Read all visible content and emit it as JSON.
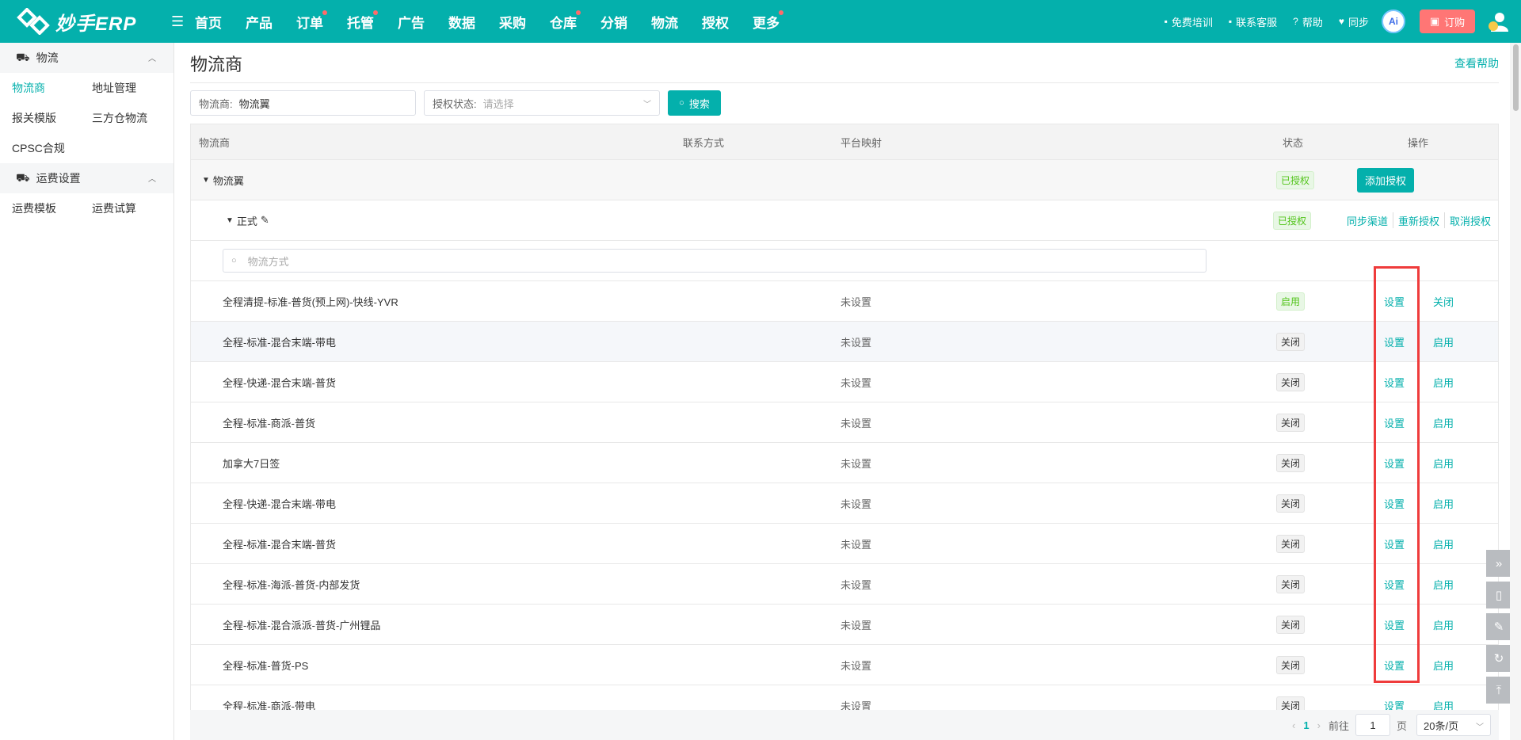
{
  "app": {
    "logo_text": "妙手ERP"
  },
  "nav": {
    "items": [
      {
        "label": "首页",
        "dot": false
      },
      {
        "label": "产品",
        "dot": false
      },
      {
        "label": "订单",
        "dot": true
      },
      {
        "label": "托管",
        "dot": true
      },
      {
        "label": "广告",
        "dot": false
      },
      {
        "label": "数据",
        "dot": false
      },
      {
        "label": "采购",
        "dot": false
      },
      {
        "label": "仓库",
        "dot": true
      },
      {
        "label": "分销",
        "dot": false
      },
      {
        "label": "物流",
        "dot": false
      },
      {
        "label": "授权",
        "dot": false
      },
      {
        "label": "更多",
        "dot": true
      }
    ],
    "tools": {
      "training": "免费培训",
      "support": "联系客服",
      "help": "帮助",
      "sync": "同步",
      "ai": "Ai",
      "order": "订购"
    }
  },
  "sidebar": {
    "group1": {
      "label": "物流"
    },
    "group1_links": [
      [
        "物流商",
        "地址管理"
      ],
      [
        "报关模版",
        "三方仓物流"
      ],
      [
        "CPSC合规"
      ]
    ],
    "group2": {
      "label": "运费设置"
    },
    "group2_links": [
      [
        "运费模板",
        "运费试算"
      ]
    ]
  },
  "page": {
    "title": "物流商",
    "help": "查看帮助"
  },
  "filters": {
    "carrier_label": "物流商:",
    "carrier_value": "物流翼",
    "auth_label": "授权状态:",
    "auth_placeholder": "请选择",
    "search_btn": "搜索"
  },
  "table": {
    "headers": {
      "carrier": "物流商",
      "contact": "联系方式",
      "mapping": "平台映射",
      "status": "状态",
      "action": "操作"
    },
    "group": {
      "name": "物流翼",
      "status": "已授权",
      "add_btn": "添加授权"
    },
    "sub": {
      "name": "正式",
      "status": "已授权",
      "sync": "同步渠道",
      "reauth": "重新授权",
      "cancel": "取消授权"
    },
    "method_placeholder": "物流方式",
    "rows": [
      {
        "name": "全程清提-标准-普货(预上网)-快线-YVR",
        "mapping": "未设置",
        "status": "启用",
        "set": "设置",
        "toggle": "关闭"
      },
      {
        "name": "全程-标准-混合末端-带电",
        "mapping": "未设置",
        "status": "关闭",
        "set": "设置",
        "toggle": "启用"
      },
      {
        "name": "全程-快递-混合末端-普货",
        "mapping": "未设置",
        "status": "关闭",
        "set": "设置",
        "toggle": "启用"
      },
      {
        "name": "全程-标准-商派-普货",
        "mapping": "未设置",
        "status": "关闭",
        "set": "设置",
        "toggle": "启用"
      },
      {
        "name": "加拿大7日签",
        "mapping": "未设置",
        "status": "关闭",
        "set": "设置",
        "toggle": "启用"
      },
      {
        "name": "全程-快递-混合末端-带电",
        "mapping": "未设置",
        "status": "关闭",
        "set": "设置",
        "toggle": "启用"
      },
      {
        "name": "全程-标准-混合末端-普货",
        "mapping": "未设置",
        "status": "关闭",
        "set": "设置",
        "toggle": "启用"
      },
      {
        "name": "全程-标准-海派-普货-内部发货",
        "mapping": "未设置",
        "status": "关闭",
        "set": "设置",
        "toggle": "启用"
      },
      {
        "name": "全程-标准-混合派派-普货-广州锂品",
        "mapping": "未设置",
        "status": "关闭",
        "set": "设置",
        "toggle": "启用"
      },
      {
        "name": "全程-标准-普货-PS",
        "mapping": "未设置",
        "status": "关闭",
        "set": "设置",
        "toggle": "启用"
      },
      {
        "name": "全程-标准-商派-带电",
        "mapping": "未设置",
        "status": "关闭",
        "set": "设置",
        "toggle": "启用"
      }
    ]
  },
  "pagination": {
    "current": "1",
    "goto_label": "前往",
    "goto_value": "1",
    "page_label": "页",
    "page_size": "20条/页"
  },
  "colors": {
    "brand": "#04b0ac",
    "highlight": "#ef3b3b"
  }
}
